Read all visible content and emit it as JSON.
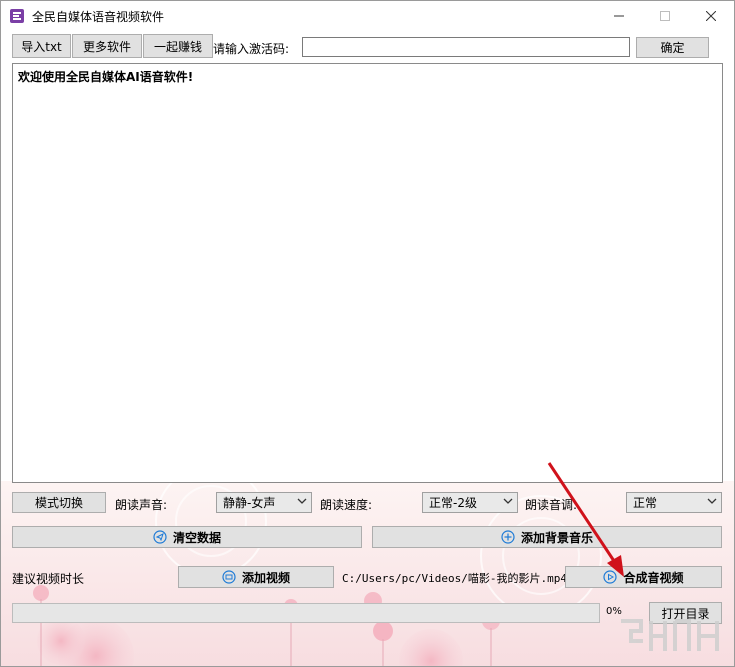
{
  "window": {
    "title": "全民自媒体语音视频软件"
  },
  "toolbar": {
    "import_label": "导入txt",
    "more_label": "更多软件",
    "earn_label": "一起赚钱",
    "activation_label": "请输入激活码:",
    "activation_value": "",
    "confirm_label": "确定"
  },
  "editor": {
    "text": "欢迎使用全民自媒体AI语音软件!"
  },
  "controls": {
    "mode_switch_label": "模式切换",
    "voice_label": "朗读声音:",
    "voice_value": "静静-女声",
    "speed_label": "朗读速度:",
    "speed_value": "正常-2级",
    "pitch_label": "朗读音调:",
    "pitch_value": "正常"
  },
  "actions": {
    "clear_label": "清空数据",
    "add_music_label": "添加背景音乐",
    "duration_label": "建议视频时长",
    "add_video_label": "添加视频",
    "video_path": "C:/Users/pc/Videos/喵影-我的影片.mp4",
    "compose_label": "合成音视频",
    "open_dir_label": "打开目录"
  },
  "progress": {
    "value": 0,
    "text": "0%"
  },
  "colors": {
    "button_bg": "#e1e1e1",
    "accent_blue": "#1e7bd6",
    "annotation_red": "#d0121b"
  },
  "icons": {
    "app": "app-icon",
    "clear": "send-circle-icon",
    "add_music": "plus-circle-icon",
    "add_video": "film-icon",
    "compose": "play-circle-icon"
  }
}
